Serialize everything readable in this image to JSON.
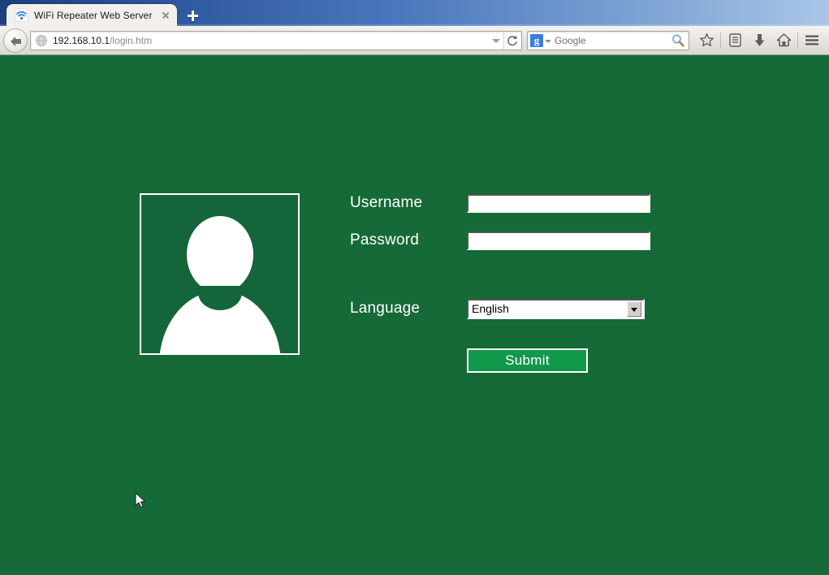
{
  "browser": {
    "tab": {
      "title": "WiFi Repeater Web Server",
      "favicon_icon": "wifi-signal-icon",
      "close_icon": "close-icon"
    },
    "new_tab_icon": "plus-icon",
    "nav": {
      "back_icon": "back-arrow-icon",
      "url_favicon_icon": "globe-icon",
      "url_host": "192.168.10.1",
      "url_path": "/login.htm",
      "url_full": "192.168.10.1/login.htm",
      "url_dropdown_icon": "chevron-down-icon",
      "reload_icon": "reload-icon"
    },
    "search": {
      "engine_logo_letter": "g",
      "engine_caret_icon": "chevron-down-icon",
      "placeholder": "Google",
      "go_icon": "magnifier-icon"
    },
    "toolbar_icons": [
      {
        "name": "bookmark-star-icon"
      },
      {
        "name": "reader-list-icon"
      },
      {
        "name": "downloads-icon"
      },
      {
        "name": "home-icon"
      },
      {
        "name": "menu-hamburger-icon"
      }
    ]
  },
  "page": {
    "avatar_icon": "user-avatar-icon",
    "form": {
      "username_label": "Username",
      "username_value": "",
      "username_placeholder": "",
      "password_label": "Password",
      "password_value": "",
      "password_placeholder": "",
      "language_label": "Language",
      "language_selected": "English",
      "language_options": [
        "English"
      ],
      "submit_label": "Submit"
    },
    "cursor_icon": "mouse-pointer-icon"
  },
  "colors": {
    "page_background": "#156a37",
    "avatar_background": "#14653a",
    "submit_green": "#12984a",
    "text_white": "#ffffff",
    "titlebar_blue_dark": "#1d3f7d",
    "titlebar_blue_light": "#a9c6e6"
  }
}
